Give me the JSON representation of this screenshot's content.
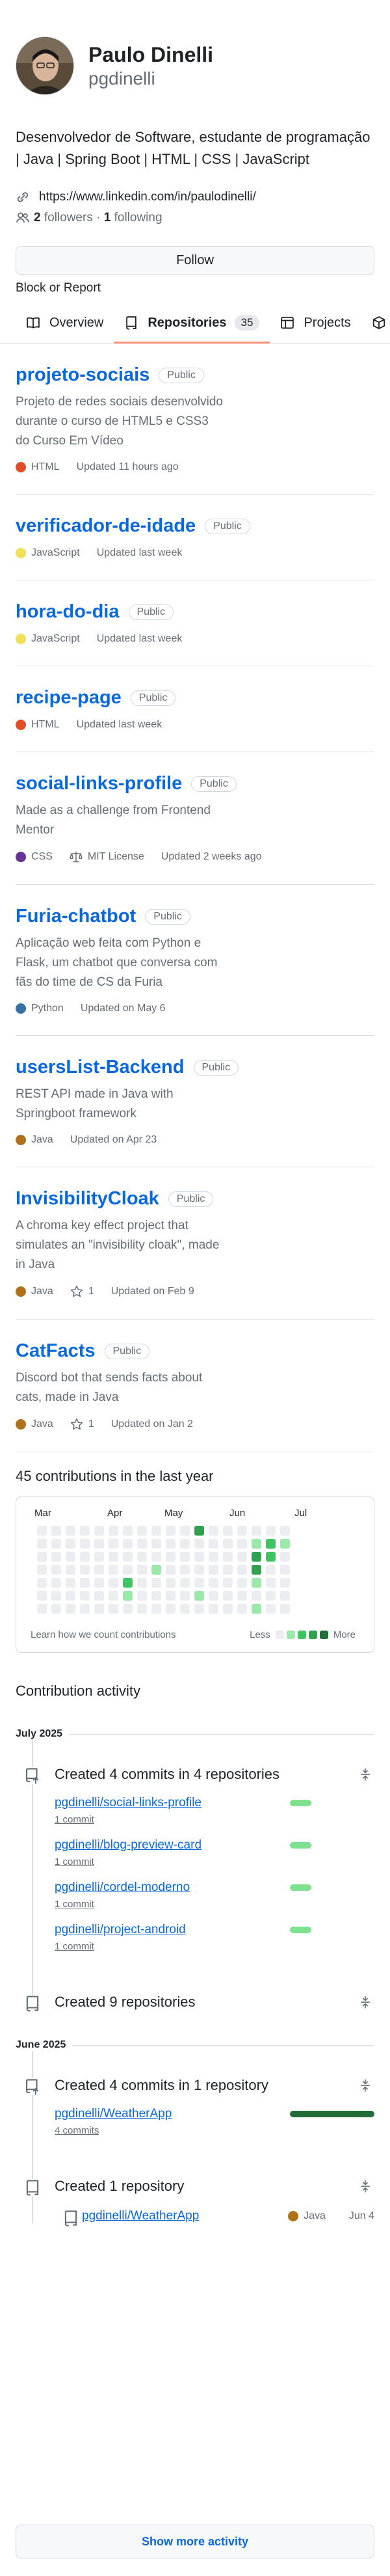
{
  "profile": {
    "full_name": "Paulo Dinelli",
    "username": "pgdinelli",
    "bio": "Desenvolvedor de Software, estudante de programação | Java | Spring Boot | HTML | CSS | JavaScript",
    "link": "https://www.linkedin.com/in/paulodinelli/",
    "followers_count": "2",
    "followers_label": "followers",
    "separator": "·",
    "following_count": "1",
    "following_label": "following",
    "follow_button": "Follow",
    "block_report": "Block or Report"
  },
  "tabs": [
    {
      "label": "Overview",
      "icon": "book-icon"
    },
    {
      "label": "Repositories",
      "icon": "repo-icon",
      "count": "35",
      "active": true
    },
    {
      "label": "Projects",
      "icon": "table-icon"
    }
  ],
  "repos": [
    {
      "name": "projeto-sociais",
      "visibility": "Public",
      "description": "Projeto de redes sociais desenvolvido durante o curso de HTML5 e CSS3 do Curso Em Vídeo",
      "language": "HTML",
      "lang_color": "#e34c26",
      "updated": "Updated 11 hours ago"
    },
    {
      "name": "verificador-de-idade",
      "visibility": "Public",
      "description": "",
      "language": "JavaScript",
      "lang_color": "#f1e05a",
      "updated": "Updated last week"
    },
    {
      "name": "hora-do-dia",
      "visibility": "Public",
      "description": "",
      "language": "JavaScript",
      "lang_color": "#f1e05a",
      "updated": "Updated last week"
    },
    {
      "name": "recipe-page",
      "visibility": "Public",
      "description": "",
      "language": "HTML",
      "lang_color": "#e34c26",
      "updated": "Updated last week"
    },
    {
      "name": "social-links-profile",
      "visibility": "Public",
      "description": "Made as a challenge from Frontend Mentor",
      "language": "CSS",
      "lang_color": "#663399",
      "license": "MIT License",
      "updated": "Updated 2 weeks ago"
    },
    {
      "name": "Furia-chatbot",
      "visibility": "Public",
      "description": "Aplicação web feita com Python e Flask, um chatbot que conversa com fãs do time de CS da Furia",
      "language": "Python",
      "lang_color": "#3572A5",
      "updated": "Updated on May 6"
    },
    {
      "name": "usersList-Backend",
      "visibility": "Public",
      "description": "REST API made in Java with Springboot framework",
      "language": "Java",
      "lang_color": "#b07219",
      "updated": "Updated on Apr 23"
    },
    {
      "name": "InvisibilityCloak",
      "visibility": "Public",
      "description": "A chroma key effect project that simulates an \"invisibility cloak\", made in Java",
      "language": "Java",
      "lang_color": "#b07219",
      "stars": "1",
      "updated": "Updated on Feb 9"
    },
    {
      "name": "CatFacts",
      "visibility": "Public",
      "description": "Discord bot that sends facts about cats, made in Java",
      "language": "Java",
      "lang_color": "#b07219",
      "stars": "1",
      "updated": "Updated on Jan 2"
    }
  ],
  "contributions": {
    "heading": "45 contributions in the last year",
    "months": [
      "Mar",
      "Apr",
      "May",
      "Jun",
      "Jul"
    ],
    "learn_link": "Learn how we count contributions",
    "less": "Less",
    "more": "More",
    "colors": [
      "#ebedf0",
      "#9be9a8",
      "#40c463",
      "#30a14e",
      "#216e39"
    ]
  },
  "activity": {
    "title": "Contribution activity",
    "groups": [
      {
        "month": "July 2025",
        "events": [
          {
            "type": "commits",
            "icon": "repo-push-icon",
            "title": "Created 4 commits in 4 repositories",
            "items": [
              {
                "repo": "pgdinelli/social-links-profile",
                "count": "1 commit",
                "fraction": 0.25
              },
              {
                "repo": "pgdinelli/blog-preview-card",
                "count": "1 commit",
                "fraction": 0.25
              },
              {
                "repo": "pgdinelli/cordel-moderno",
                "count": "1 commit",
                "fraction": 0.25
              },
              {
                "repo": "pgdinelli/project-android",
                "count": "1 commit",
                "fraction": 0.25
              }
            ]
          },
          {
            "type": "created",
            "icon": "repo-icon",
            "title": "Created 9 repositories"
          }
        ]
      },
      {
        "month": "June 2025",
        "events": [
          {
            "type": "commits",
            "icon": "repo-push-icon",
            "title": "Created 4 commits in 1 repository",
            "items": [
              {
                "repo": "pgdinelli/WeatherApp",
                "count": "4 commits",
                "fraction": 1.0
              }
            ]
          },
          {
            "type": "created-one",
            "icon": "repo-icon",
            "title": "Created 1 repository",
            "repo": "pgdinelli/WeatherApp",
            "language": "Java",
            "lang_color": "#b07219",
            "date": "Jun 4"
          }
        ]
      }
    ],
    "show_more": "Show more activity"
  }
}
